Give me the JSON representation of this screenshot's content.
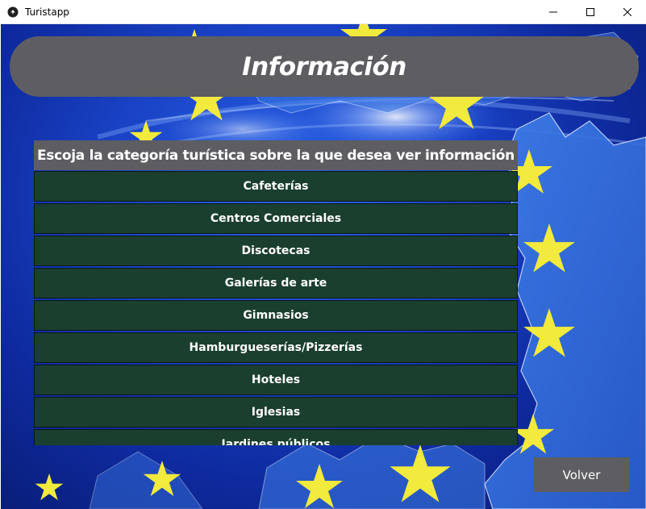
{
  "window": {
    "title": "Turistapp",
    "controls": {
      "minimize": "minimize-icon",
      "maximize": "maximize-icon",
      "close": "close-icon"
    }
  },
  "header": {
    "title": "Información"
  },
  "panel": {
    "heading": "Escoja la categoría turística sobre la que desea ver información",
    "categories": [
      "Cafeterías",
      "Centros Comerciales",
      "Discotecas",
      "Galerías de arte",
      "Gimnasios",
      "Hamburgueserías/Pizzerías",
      "Hoteles",
      "Iglesias",
      "Jardines públicos"
    ]
  },
  "footer": {
    "back_label": "Volver"
  },
  "colors": {
    "panel_gray": "#5e5d62",
    "item_green": "#1b3f2e",
    "star_yellow": "#f2ea3c",
    "background_blue": "#1a44c8"
  }
}
